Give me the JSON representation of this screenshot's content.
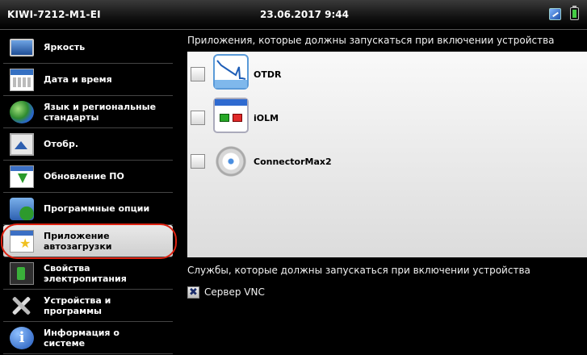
{
  "titlebar": {
    "device": "KIWI-7212-M1-EI",
    "datetime": "23.06.2017 9:44",
    "icons": [
      "network-icon",
      "battery-icon"
    ]
  },
  "sidebar": {
    "items": [
      {
        "label": "Яркость",
        "icon": "brightness-monitor-icon"
      },
      {
        "label": "Дата и время",
        "icon": "calendar-icon"
      },
      {
        "label": "Язык и региональные стандарты",
        "icon": "globe-icon"
      },
      {
        "label": "Отобр.",
        "icon": "display-icon"
      },
      {
        "label": "Обновление ПО",
        "icon": "software-update-icon"
      },
      {
        "label": "Программные опции",
        "icon": "puzzle-icon"
      },
      {
        "label": "Приложение автозагрузки",
        "icon": "startup-app-icon",
        "selected": true
      },
      {
        "label": "Свойства электропитания",
        "icon": "power-icon"
      },
      {
        "label": "Устройства и программы",
        "icon": "tools-icon"
      },
      {
        "label": "Информация о системе",
        "icon": "info-icon"
      }
    ],
    "highlight_color": "#d21a1a"
  },
  "main": {
    "apps_heading": "Приложения, которые должны запускаться при включении устройства",
    "apps": [
      {
        "name": "OTDR",
        "checked": false,
        "icon": "otdr-icon"
      },
      {
        "name": "iOLM",
        "checked": false,
        "icon": "iolm-icon"
      },
      {
        "name": "ConnectorMax2",
        "checked": false,
        "icon": "connectormax-icon"
      }
    ],
    "services_heading": "Службы, которые должны запускаться при включении устройства",
    "services": [
      {
        "name": "Сервер VNC",
        "checked": true,
        "mark": "✖"
      }
    ]
  }
}
